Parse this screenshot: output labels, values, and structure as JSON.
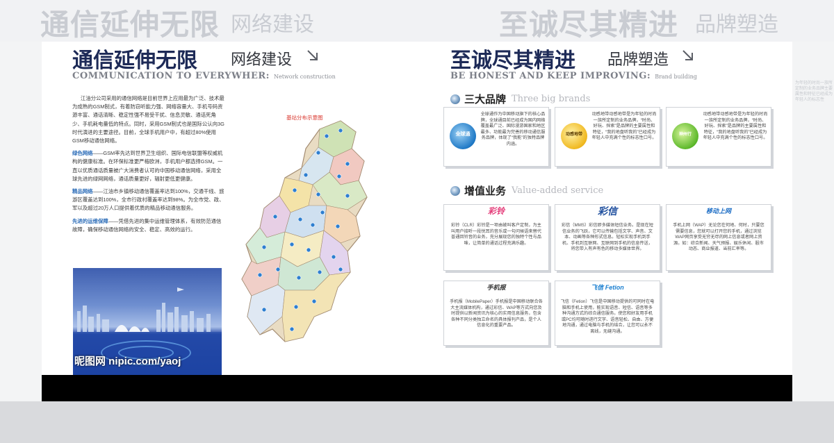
{
  "echo": {
    "left_title": "通信延伸无限",
    "left_sub": "网络建设",
    "right_title": "至诚尽其精进",
    "right_sub": "品牌塑造"
  },
  "left": {
    "title": "通信延伸无限",
    "subtitle": "网络建设",
    "en_title": "COMMUNICATION TO EVERYWHER:",
    "en_small": "Network construction",
    "para1": "江油分公司采用的通信网络是目前世界上应用最为广泛、技术最为成熟的GSM制式，有着防窃听能力强、网络容量大、手机号码资源丰富、通话清晰、稳定性强不易受干扰、信息灵敏、通话死角少、手机耗电量低的特点。同时，采用GSM制式也是国际公认向3G时代演进的主要途径。目前，全球手机用户中，有超过80%使用GSM移动通信网络。",
    "para2_hl": "绿色网络",
    "para2": "——GSM率先达到世界卫生组织、国际电信联盟等权威机构的健康标准。在环保标准更严格欧洲，手机用户都选择GSM。一直以优质通话质量被广大消费者认可的中国移动通信网络，采用全球先进的绿网网络，通话质量更好，辐射更低更健康。",
    "para3_hl": "精品网络",
    "para3": "——江油市乡镇移动通信覆盖率达到100%，交通干线、旅游区覆盖达到100%，全市行政村覆盖率达到98%。为全市党、政、军以及超过20万人口提供着优质的精品移动通信服务。",
    "para4_hl": "先进的运维保障",
    "para4": "——凭借先进的集中运维管理体系，有效防范通信故障，确保移动通信网络的安全、稳定、高效的运行。",
    "map_title": "基站分布示意图",
    "photo_watermark": "昵图网 nipic.com/yaoj"
  },
  "right": {
    "title": "至诚尽其精进",
    "subtitle": "品牌塑造",
    "en_title": "BE HONEST AND KEEP IMPROVING:",
    "en_small": "Brand building",
    "brands_head_cn": "三大品牌",
    "brands_head_en": "Three big brands",
    "brands": [
      {
        "name": "全球通",
        "text": "全球通作为中国移动旗下的核心品牌，全球通目前已经成为国内网络覆盖最广泛、国际漫游国家和地区最多、功能最为完善的移动通信服务品牌，体现了“我能”的独特品牌内涵。"
      },
      {
        "name": "动感地带",
        "text": "动感地带动感地带是为年轻的时尚一族所定制的业务品牌，“时尚、好玩、探索”是品牌的主要属性和特征，“我的地盘听我的”已经成为年轻人中充满个性的标志性口号。"
      },
      {
        "name": "神州行",
        "text": "动感地带动感地带是为年轻的时尚一族所定制的业务品牌，“时尚、好玩、探索”是品牌的主要属性和特征，“我的地盘听我的”已经成为年轻人中充满个性的标志性口号。"
      }
    ],
    "vas_head_cn": "增值业务",
    "vas_head_en": "Value-added service",
    "vas": [
      {
        "logo": "彩铃",
        "text": "彩铃（CLR）彩铃是一项由被叫客户定制，为主叫用户接听一段悦耳的音乐或一句问候语来替代普通回铃音的业务，充分展现您的独特个性与品味，让简单的通话过程充满乐趣。"
      },
      {
        "logo": "彩信",
        "text": "彩信（MMS）彩信即多媒体短信业务。是现在短信业务的飞跃，它可以传输包括文字、声音、文本、动画等各种形式信息。轻松实现手机到手机、手机到互联网、互联网到手机的信息传送，将您带入有声有色的移动多媒体世界。"
      },
      {
        "logo": "移动上网",
        "text": "手机上网（WAP）无论您在何地、何时，只要您需要信息，您就可以打开您的手机，通过浏览WAP网页享受无穷无尽的网上信息或者网上资源。如：综合新闻、天气预报、娱乐休闲、股市动态、商业报道、当前汇率等。"
      },
      {
        "logo": "手机报",
        "text": "手机报（MobilePaper）手机报是中国移动联合各大主流媒体机构，通过彩信、WAP等方式向您及时提供以新闻资讯为核心的实用信息服务，包含各种不同分类独立命名的具体报刊产品，是个人信息化的重要产品。"
      },
      {
        "logo": "飞信 Fetion",
        "text": "飞信（Fetion）飞信是中国移动提供的可同时在电脑和手机上使用，能实现语音、短信、语音等多种沟通方式的综合通信服务。使您和好友用手机或PC均可随时进行文字、语音轻松、自由、方便地沟通，通过电脑与手机的结合，让您可以永不离线，无缝沟通。"
      }
    ],
    "ghost_text": "为年轻的时尚一族所定制的业务品牌主要属性和特征已经成为年轻人的标志性"
  }
}
